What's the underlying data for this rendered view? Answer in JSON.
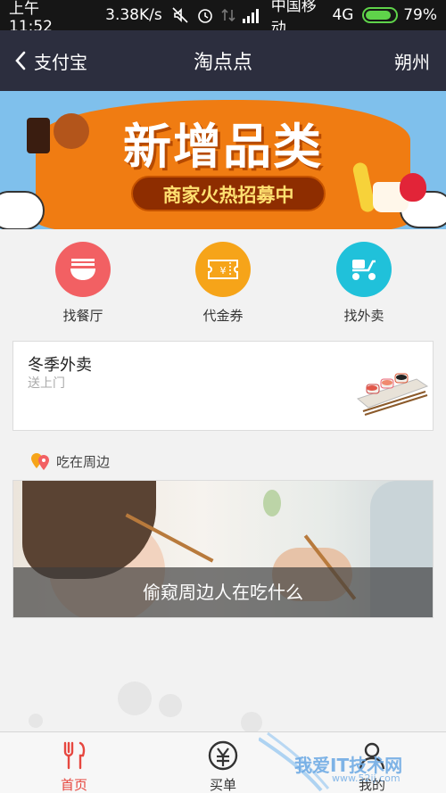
{
  "status_bar": {
    "time": "上午11:52",
    "speed": "3.38K/s",
    "carrier": "中国移动",
    "network": "4G",
    "battery_percent": "79%",
    "battery_level": 0.79,
    "icons": [
      "mute-icon",
      "alarm-icon",
      "data-arrows-icon",
      "signal-icon"
    ]
  },
  "nav": {
    "back_label": "支付宝",
    "title": "淘点点",
    "city": "朔州"
  },
  "banner": {
    "title": "新增品类",
    "subtitle": "商家火热招募中"
  },
  "quick_entries": [
    {
      "label": "找餐厅",
      "icon": "bowl-icon",
      "color": "#f26063"
    },
    {
      "label": "代金券",
      "icon": "voucher-icon",
      "color": "#f6a419"
    },
    {
      "label": "找外卖",
      "icon": "scooter-icon",
      "color": "#20c1da"
    }
  ],
  "promo_card": {
    "title": "冬季外卖",
    "subtitle": "送上门"
  },
  "nearby": {
    "section_title": "吃在周边",
    "photo_caption": "偷窥周边人在吃什么"
  },
  "tabs": [
    {
      "label": "首页",
      "icon": "fork-knife-icon",
      "active": true
    },
    {
      "label": "买单",
      "icon": "yuan-circle-icon",
      "active": false
    },
    {
      "label": "我的",
      "icon": "person-icon",
      "active": false
    }
  ],
  "watermark": {
    "text": "我爱IT技术网",
    "url": "www.52ij.com"
  },
  "colors": {
    "accent_red": "#e6473f",
    "nav_bg": "#2c2e3e",
    "banner_orange": "#f07c12"
  }
}
